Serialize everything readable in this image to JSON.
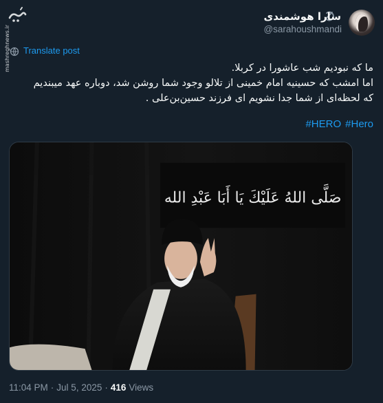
{
  "post": {
    "display_name": "سارا هوشمندی",
    "handle": "@sarahoushmandi",
    "translate_label": "Translate post",
    "text_lines": [
      "ما که نبودیم شب عاشورا در کربلا.",
      "اما امشب که حسینیه امام خمینی از تلالو وجود شما روشن شد، دوباره عهد میبندیم",
      "که لحظه‌ای از شما جدا نشویم ای فرزند حسین‌بن‌علی ."
    ],
    "hashtags": [
      "#HERO",
      "#Hero"
    ],
    "banner_text": "صَلَّى اللهُ عَلَيْكَ يَا أَبَا عَبْدِ الله",
    "time": "11:04 PM",
    "separator": "·",
    "date": "Jul 5, 2025",
    "views_count": "416",
    "views_label": "Views"
  },
  "watermark": {
    "text": "mashreghnews.ir"
  },
  "colors": {
    "background": "#15202b",
    "accent": "#1d9bf0",
    "text": "#f7f9f9",
    "muted": "#8b98a5"
  },
  "icons": {
    "site_logo": "mashregh-logo-icon",
    "grok": "grok-icon",
    "translate": "globe-icon"
  }
}
